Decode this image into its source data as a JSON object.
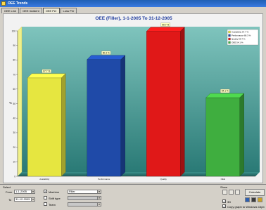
{
  "window": {
    "title": "OEE Trends"
  },
  "tabs": [
    {
      "label": "OEE Line",
      "active": false
    },
    {
      "label": "OEE Incident",
      "active": false
    },
    {
      "label": "OEE Per",
      "active": true
    },
    {
      "label": "Loss Per",
      "active": false
    }
  ],
  "chart_data": {
    "type": "bar",
    "title": "OEE (Filler), 1-1-2005 To 31-12-2005",
    "ylabel": "%",
    "ylim": [
      0,
      100
    ],
    "yticks": [
      0,
      10,
      20,
      30,
      40,
      50,
      60,
      70,
      80,
      90,
      100
    ],
    "categories": [
      "Availability",
      "Performance",
      "Quality",
      "OEE"
    ],
    "values": [
      67.7,
      80.3,
      99.7,
      54.1
    ],
    "value_labels": [
      "67.7 %",
      "80.3 %",
      "99.7 %",
      "54.1 %"
    ],
    "colors": [
      "#e6e640",
      "#1f4aa8",
      "#e01818",
      "#3fae3f"
    ],
    "legend_position": "top-right",
    "legend": [
      {
        "label": "Availability 67.7 %",
        "color": "#e6e640"
      },
      {
        "label": "Performance 80.3 %",
        "color": "#1f4aa8"
      },
      {
        "label": "Quality 99.7 %",
        "color": "#e01818"
      },
      {
        "label": "OEE 54.1 %",
        "color": "#3fae3f"
      }
    ],
    "grid": false
  },
  "select_panel": {
    "label": "Select",
    "from_label": "From",
    "from_value": "1-1-2005",
    "to_label": "To",
    "to_value": "31-12-2005",
    "machine_label": "Machine",
    "machine_checked": true,
    "machine_value": "Filler",
    "shift_label": "Shift type",
    "shift_checked": false,
    "team_label": "Team",
    "team_checked": false
  },
  "show_panel": {
    "label": "Show",
    "calculate_label": "Calculate",
    "option1_label": "3D",
    "option1_checked": true,
    "option2_label": "Copy graph to Windows Clipb",
    "option2_checked": true
  }
}
